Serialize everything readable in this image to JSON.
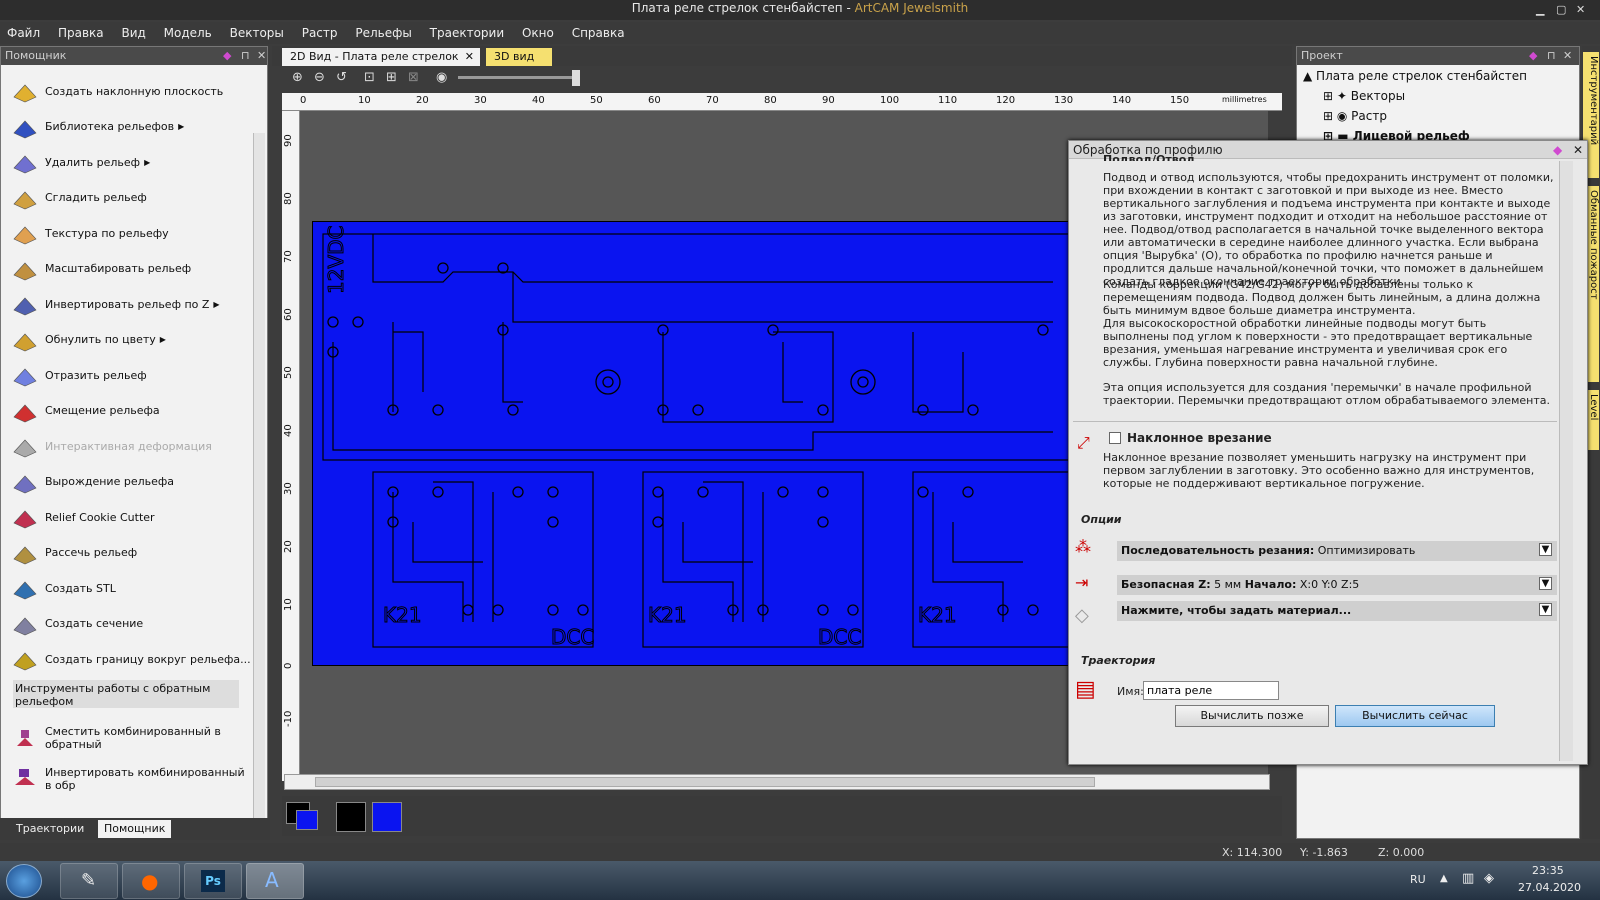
{
  "window": {
    "title_doc": "Плата реле стрелок стенбайстеп - ",
    "title_app": "ArtCAM Jewelsmith"
  },
  "menu": [
    "Файл",
    "Правка",
    "Вид",
    "Модель",
    "Векторы",
    "Растр",
    "Рельефы",
    "Траектории",
    "Окно",
    "Справка"
  ],
  "left_panel": {
    "title": "Помощник",
    "items": [
      {
        "label": "Создать наклонную плоскость",
        "arrow": false
      },
      {
        "label": "Библиотека рельефов",
        "arrow": true
      },
      {
        "label": "Удалить рельеф",
        "arrow": true
      },
      {
        "label": "Сгладить рельеф",
        "arrow": false
      },
      {
        "label": "Текстура по рельефу",
        "arrow": false
      },
      {
        "label": "Масштабировать рельеф",
        "arrow": false
      },
      {
        "label": "Инвертировать рельеф по Z",
        "arrow": true
      },
      {
        "label": "Обнулить по цвету",
        "arrow": true
      },
      {
        "label": "Отразить рельеф",
        "arrow": false
      },
      {
        "label": "Смещение рельефа",
        "arrow": false
      },
      {
        "label": "Интерактивная деформация",
        "arrow": false,
        "disabled": true
      },
      {
        "label": "Вырождение рельефа",
        "arrow": false
      },
      {
        "label": "Relief Cookie Cutter",
        "arrow": false
      },
      {
        "label": "Рассечь рельеф",
        "arrow": false
      },
      {
        "label": "Создать STL",
        "arrow": false
      },
      {
        "label": "Создать сечение",
        "arrow": false
      },
      {
        "label": "Создать границу вокруг рельефа...",
        "arrow": false
      }
    ],
    "section_title": "Инструменты работы с обратным рельефом",
    "section_items": [
      "Сместить комбинированный в обратный",
      "Инвертировать комбинированный в обр"
    ],
    "tabs": [
      "Траектории",
      "Помощник"
    ]
  },
  "doc_tabs": [
    "2D Вид - Плата реле стрелок",
    "3D вид"
  ],
  "ruler": {
    "ticks": [
      "0",
      "10",
      "20",
      "30",
      "40",
      "50",
      "60",
      "70",
      "80",
      "90",
      "100",
      "110",
      "120",
      "130",
      "140",
      "150"
    ],
    "unit": "millimetres",
    "vticks": [
      "90",
      "80",
      "70",
      "60",
      "50",
      "40",
      "30",
      "20",
      "10",
      "0",
      "-10"
    ]
  },
  "board": {
    "labels": {
      "v12": "12VDC",
      "k21": "K21",
      "dcc": "DCC"
    },
    "color": "#0a14f0"
  },
  "right_panel": {
    "title": "Проект",
    "tree": [
      "Плата реле стрелок стенбайстеп",
      "Векторы",
      "Растр",
      "Лицевой рельеф"
    ]
  },
  "side_tabs": [
    "Инструментарий",
    "Обманные пожарост",
    "Level"
  ],
  "dialog": {
    "title": "Обработка по профилю",
    "top_cut_label": "Подвод/Отвод",
    "paragraph1": "Подвод и отвод используются, чтобы предохранить инструмент от поломки, при вхождении в контакт с заготовкой и при выходе из нее. Вместо вертикального заглубления и подъема инструмента при контакте и выходе из заготовки, инструмент подходит и отходит на небольшое расстояние от нее. Подвод/отвод располагается в начальной точке выделенного вектора или автоматически в середине наиболее длинного участка. Если выбрана опция 'Вырубка' (O), то обработка по профилю начнется раньше и продлится дальше начальной/конечной точки, что поможет в дальнейшем создать гладкое окончание траектории обработки.",
    "paragraph2": "Команды коррекции (G42/G42) могут быть добавлены только к перемещениям подвода. Подвод должен быть линейным, а длина должна быть минимум вдвое больше диаметра инструмента.",
    "paragraph3": "Для высокоскоростной обработки линейные подводы могут быть выполнены под углом к поверхности - это предотвращает вертикальные врезания, уменьшая нагревание инструмента и увеличивая срок его службы. Глубина поверхности равна начальной глубине.",
    "paragraph4": "Эта опция используется для создания 'перемычки' в начале профильной траектории. Перемычки предотвращают отлом обрабатываемого элемента.",
    "ramp_label": "Наклонное врезание",
    "ramp_text": "Наклонное врезание позволяет уменьшить нагрузку на инструмент при первом заглублении в заготовку. Это особенно важно для инструментов, которые не поддерживают вертикальное погружение.",
    "options_title": "Опции",
    "opt_seq_label": "Последовательность резания:",
    "opt_seq_value": "Оптимизировать",
    "opt_safez_label": "Безопасная Z:",
    "opt_safez_value": "5 мм",
    "opt_start_label": "Начало:",
    "opt_start_value": "X:0 Y:0 Z:5",
    "opt_material": "Нажмите, чтобы задать материал...",
    "toolpath_title": "Траектория",
    "name_label": "Имя:",
    "name_value": "плата реле",
    "btn_later": "Вычислить позже",
    "btn_now": "Вычислить сейчас"
  },
  "status": {
    "x": "X: 114.300",
    "y": "Y: -1.863",
    "z": "Z: 0.000"
  },
  "taskbar": {
    "lang": "RU",
    "time": "23:35",
    "date": "27.04.2020"
  }
}
